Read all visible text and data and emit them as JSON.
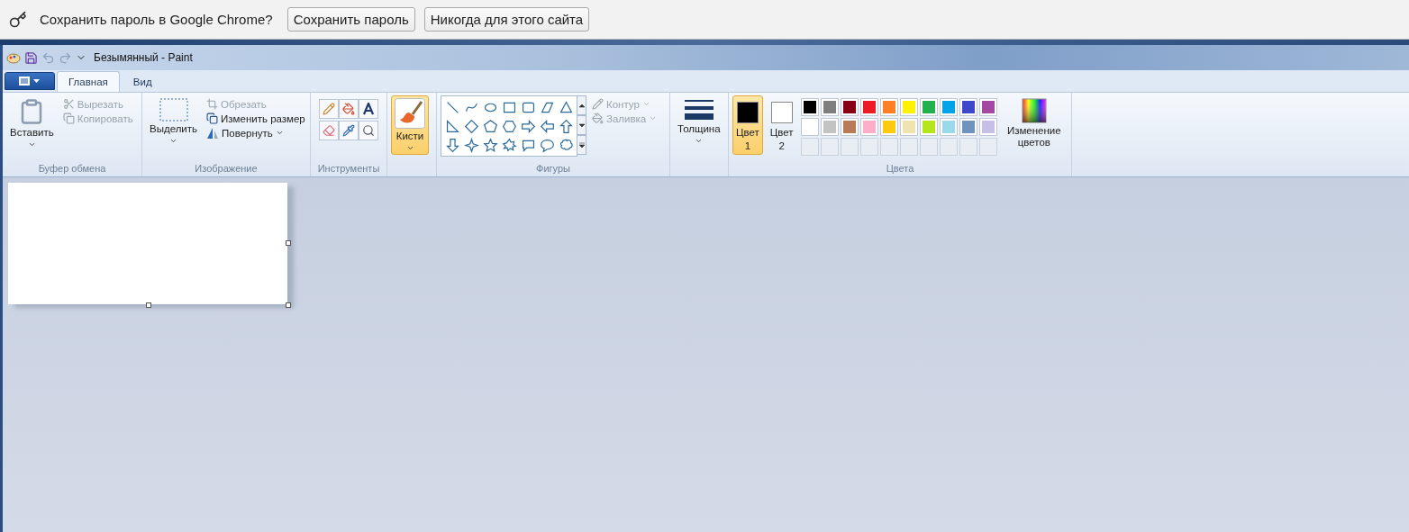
{
  "infobar": {
    "message": "Сохранить пароль в Google Chrome?",
    "buttons": [
      "Сохранить пароль",
      "Никогда для этого сайта"
    ]
  },
  "window": {
    "title": "Безымянный - Paint"
  },
  "tabs": [
    {
      "label": "Главная",
      "selected": true
    },
    {
      "label": "Вид",
      "selected": false
    }
  ],
  "ribbon": {
    "clipboard": {
      "label": "Буфер обмена",
      "paste": "Вставить",
      "cut": {
        "label": "Вырезать",
        "disabled": true
      },
      "copy": {
        "label": "Копировать",
        "disabled": true
      }
    },
    "image": {
      "label": "Изображение",
      "select": "Выделить",
      "crop": {
        "label": "Обрезать",
        "disabled": true
      },
      "resize": {
        "label": "Изменить размер",
        "disabled": false
      },
      "rotate": {
        "label": "Повернуть",
        "disabled": false
      }
    },
    "tools": {
      "label": "Инструменты"
    },
    "brushes": {
      "label": "Кисти",
      "selected": true
    },
    "shapes": {
      "label": "Фигуры",
      "outline": {
        "label": "Контур",
        "disabled": true
      },
      "fill": {
        "label": "Заливка",
        "disabled": true
      }
    },
    "size": {
      "label": "Толщина"
    },
    "colors": {
      "label": "Цвета",
      "color1": {
        "label": "Цвет",
        "number": "1",
        "color": "#000000",
        "selected": true
      },
      "color2": {
        "label": "Цвет",
        "number": "2",
        "color": "#ffffff",
        "selected": false
      },
      "palette": [
        {
          "color": "#000000"
        },
        {
          "color": "#7f7f7f"
        },
        {
          "color": "#880015"
        },
        {
          "color": "#ed1c24"
        },
        {
          "color": "#ff7f27"
        },
        {
          "color": "#fff200"
        },
        {
          "color": "#22b14c"
        },
        {
          "color": "#00a2e8"
        },
        {
          "color": "#3f48cc"
        },
        {
          "color": "#a349a4"
        },
        {
          "color": "#ffffff"
        },
        {
          "color": "#c3c3c3"
        },
        {
          "color": "#b97a57"
        },
        {
          "color": "#ffaec9"
        },
        {
          "color": "#ffc90e"
        },
        {
          "color": "#efe4b0"
        },
        {
          "color": "#b5e61d"
        },
        {
          "color": "#99d9ea"
        },
        {
          "color": "#7092be"
        },
        {
          "color": "#c8bfe7"
        }
      ],
      "edit": "Изменение цветов"
    }
  }
}
